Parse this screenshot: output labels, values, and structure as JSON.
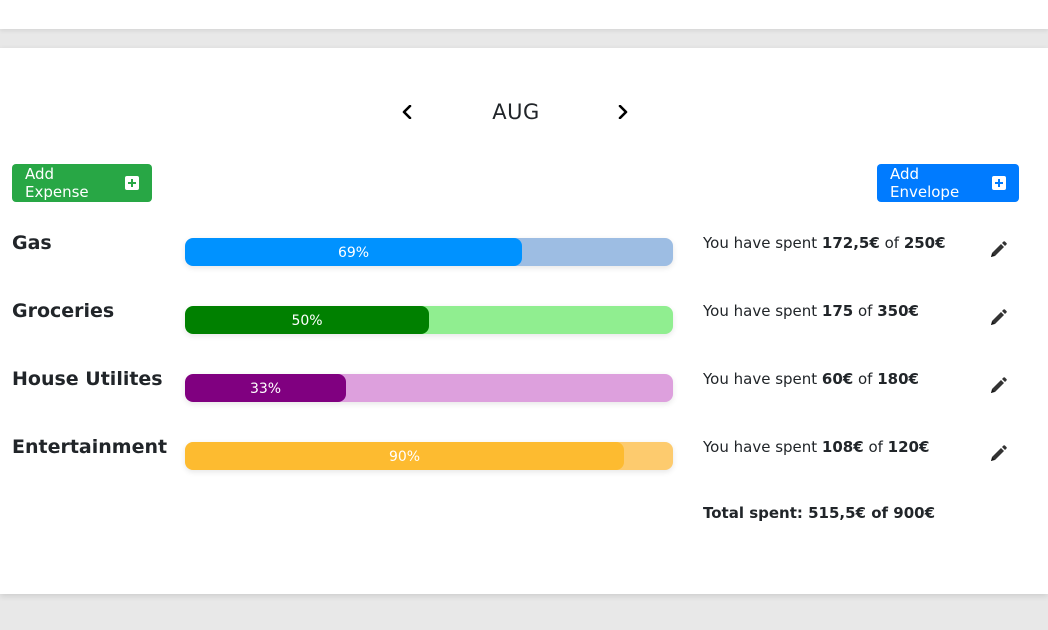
{
  "month_nav": {
    "month": "AUG",
    "prev_icon": "chevron-left-icon",
    "next_icon": "chevron-right-icon"
  },
  "buttons": {
    "add_expense": "Add Expense",
    "add_envelope": "Add Envelope",
    "plus_icon": "plus-square-icon"
  },
  "envelopes": [
    {
      "name": "Gas",
      "percent": 69,
      "percent_label": "69%",
      "fill_color": "#0092ff",
      "track_color": "#9dbde3",
      "spent_prefix": "You have spent ",
      "spent": "172,5€",
      "of_word": " of ",
      "budget": "250€"
    },
    {
      "name": "Groceries",
      "percent": 50,
      "percent_label": "50%",
      "fill_color": "#008000",
      "track_color": "#90ee90",
      "spent_prefix": "You have spent ",
      "spent": "175",
      "of_word": " of ",
      "budget": "350€"
    },
    {
      "name": "House Utilites",
      "percent": 33,
      "percent_label": "33%",
      "fill_color": "#800080",
      "track_color": "#dda0dd",
      "spent_prefix": "You have spent ",
      "spent": "60€",
      "of_word": " of ",
      "budget": "180€"
    },
    {
      "name": "Entertainment",
      "percent": 90,
      "percent_label": "90%",
      "fill_color": "#fdbb30",
      "track_color": "#fdcb6e",
      "spent_prefix": "You have spent ",
      "spent": "108€",
      "of_word": " of ",
      "budget": "120€"
    }
  ],
  "edit_icon": "pencil-icon",
  "total": "Total spent: 515,5€ of 900€"
}
